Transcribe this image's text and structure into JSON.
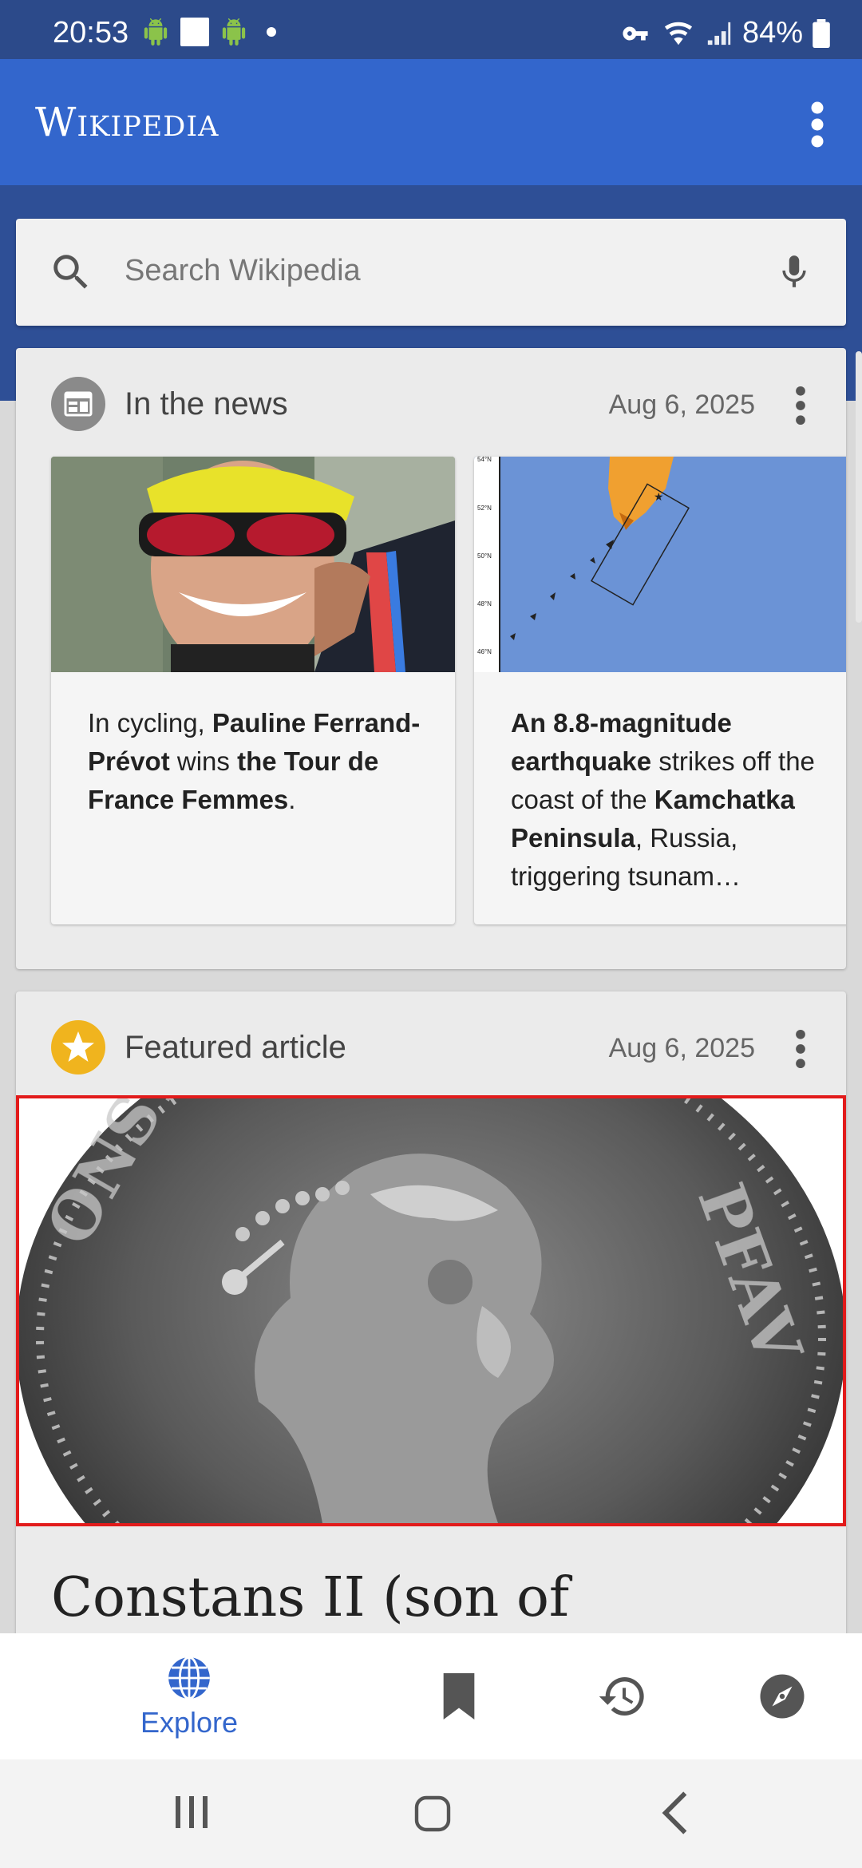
{
  "status_bar": {
    "time": "20:53",
    "battery": "84%",
    "icons": [
      "android-icon",
      "square-notification-icon",
      "android-icon",
      "dot-icon",
      "vpn-key-icon",
      "wifi-icon",
      "signal-icon",
      "battery-icon"
    ]
  },
  "app_bar": {
    "logo": "Wikipedia",
    "overflow_icon": "more-vert-icon"
  },
  "search": {
    "placeholder": "Search Wikipedia",
    "icon": "search-icon",
    "mic_icon": "mic-icon"
  },
  "news_card": {
    "title": "In the news",
    "date": "Aug 6, 2025",
    "icon": "news-calendar-icon",
    "items": [
      {
        "image": "cyclist-photo",
        "parts": [
          {
            "text": "In cycling, ",
            "bold": false
          },
          {
            "text": "Pauline Ferrand-Prévot",
            "bold": true
          },
          {
            "text": " wins ",
            "bold": false
          },
          {
            "text": "the Tour de France Femmes",
            "bold": true
          },
          {
            "text": ".",
            "bold": false
          }
        ]
      },
      {
        "image": "kamchatka-map",
        "parts": [
          {
            "text": "An 8.8-magnitude earthquake",
            "bold": true
          },
          {
            "text": " strikes off the coast of the ",
            "bold": false
          },
          {
            "text": "Kamchatka Peninsula",
            "bold": true
          },
          {
            "text": ", Russia, triggering tsunam…",
            "bold": false
          }
        ],
        "map_labels": [
          "54°N",
          "52°N",
          "50°N",
          "48°N",
          "46°N"
        ]
      }
    ]
  },
  "featured_card": {
    "title": "Featured article",
    "date": "Aug 6, 2025",
    "icon": "star-icon",
    "image": "silver-coin-photo",
    "article_title": "Constans II (son of"
  },
  "bottom_nav": {
    "items": [
      {
        "label": "Explore",
        "icon": "globe-icon",
        "active": true
      },
      {
        "label": "",
        "icon": "bookmark-icon",
        "active": false
      },
      {
        "label": "",
        "icon": "history-icon",
        "active": false
      },
      {
        "label": "",
        "icon": "compass-icon",
        "active": false
      }
    ]
  },
  "colors": {
    "status_bar": "#2c4a8a",
    "app_bar": "#3366cc",
    "accent": "#3366cc",
    "star": "#f0b41e",
    "highlight_border": "#e21b1b"
  }
}
